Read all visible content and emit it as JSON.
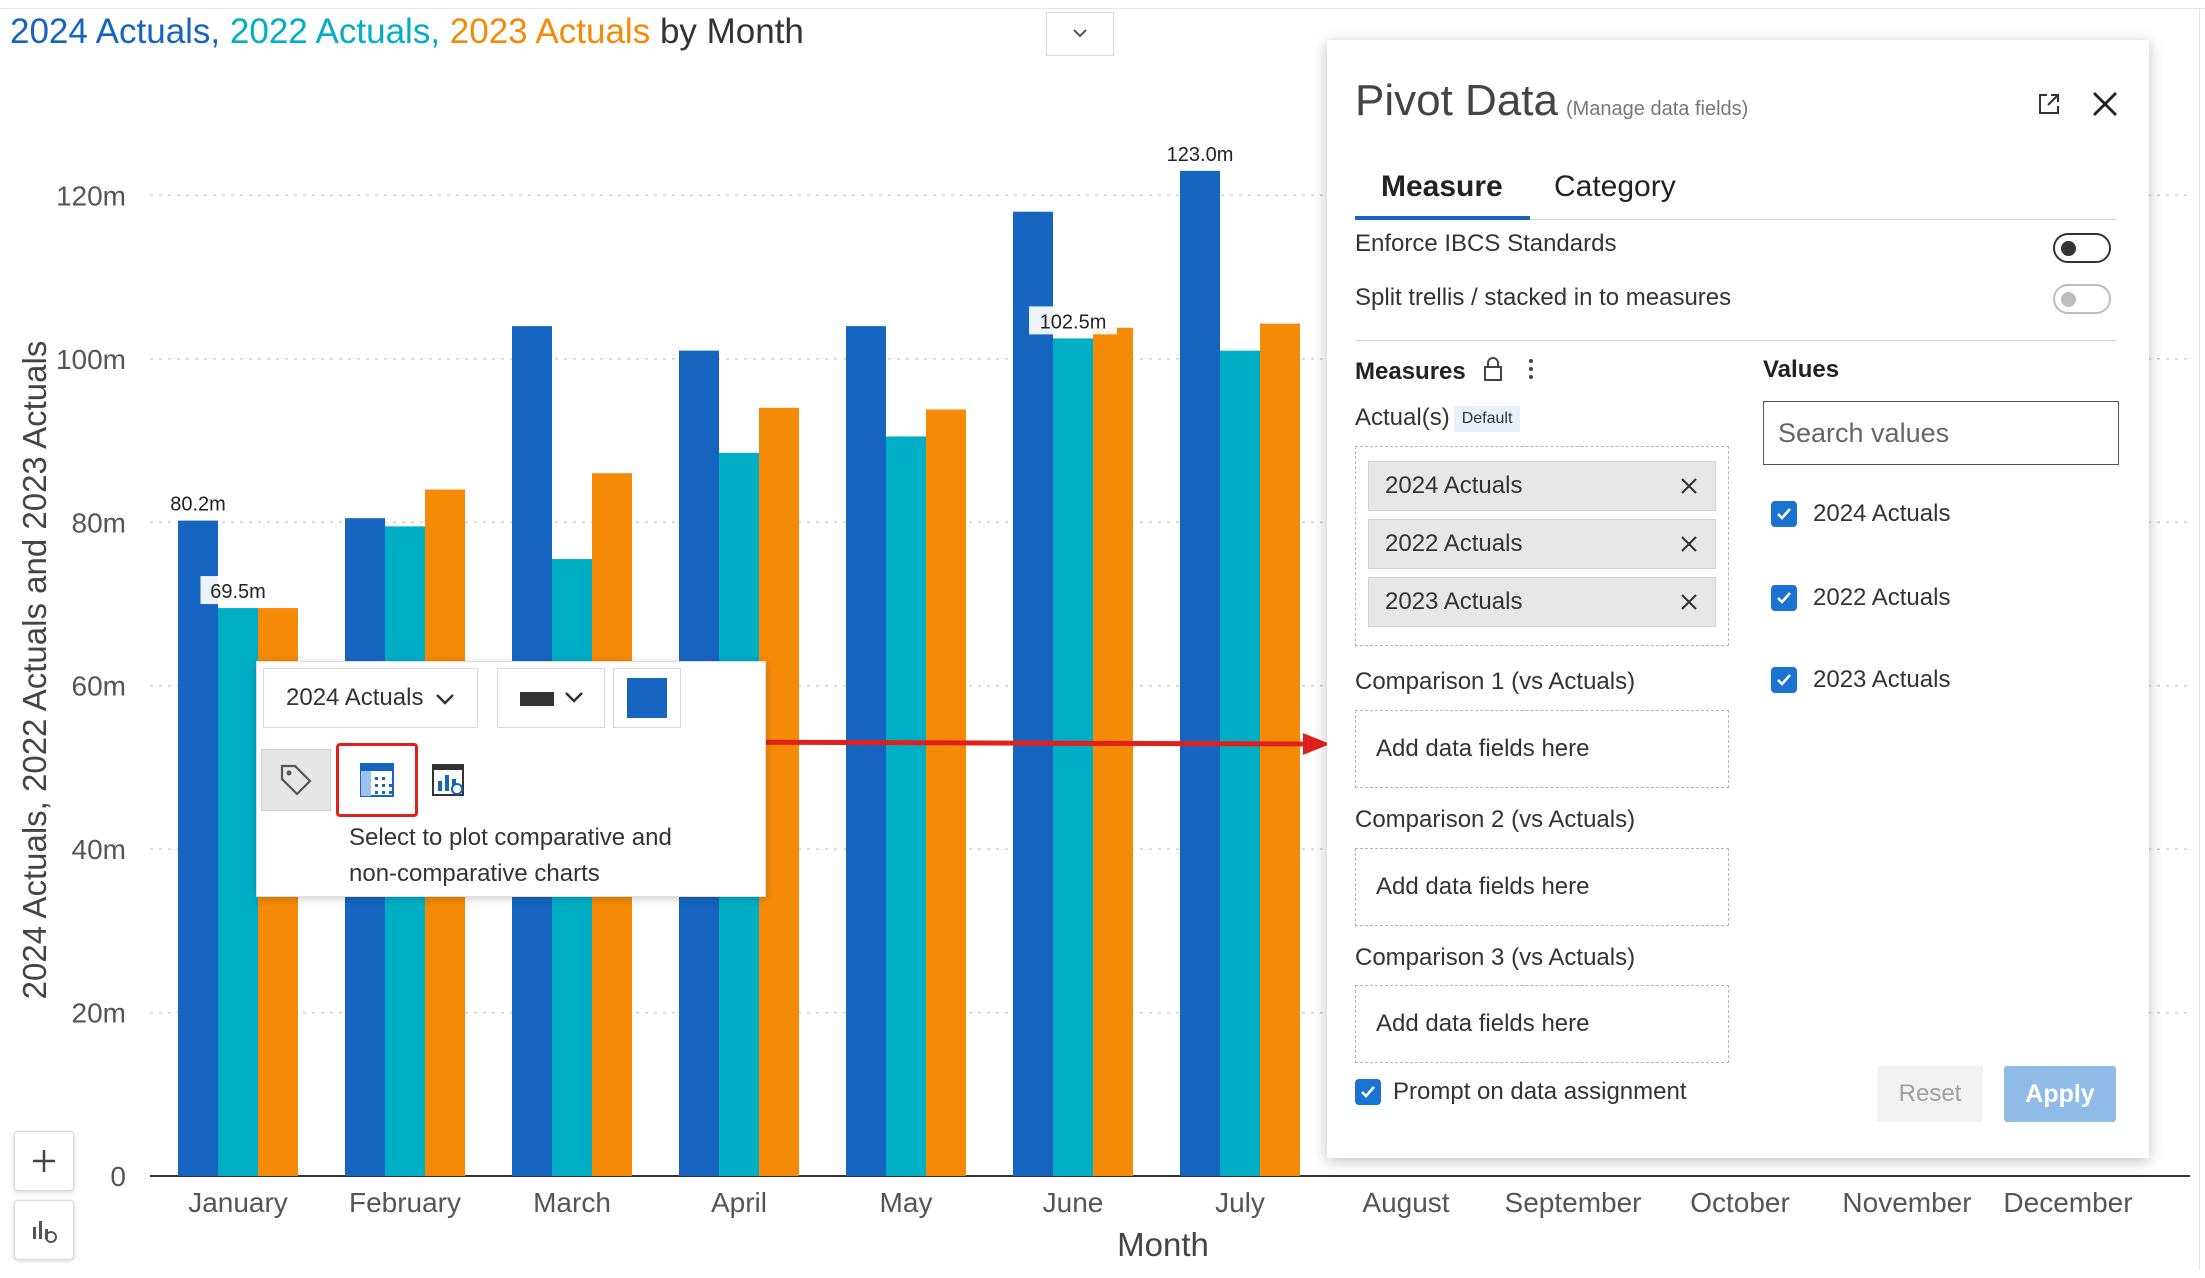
{
  "title": {
    "parts": [
      {
        "text": "2024 Actuals,",
        "color": "#1565c0"
      },
      {
        "text": "2022 Actuals,",
        "color": "#00aec6"
      },
      {
        "text": "2023 Actuals",
        "color": "#f58a07"
      },
      {
        "text": "by Month",
        "color": "#333333"
      }
    ]
  },
  "chart_data": {
    "type": "bar",
    "xlabel": "Month",
    "ylabel": "2024 Actuals, 2022 Actuals and 2023 Actuals",
    "ylim": [
      0,
      128
    ],
    "yticks": [
      0,
      20,
      40,
      60,
      80,
      100,
      120
    ],
    "ytick_labels": [
      "0",
      "20m",
      "40m",
      "60m",
      "80m",
      "100m",
      "120m"
    ],
    "grid": true,
    "categories": [
      "January",
      "February",
      "March",
      "April",
      "May",
      "June",
      "July",
      "August",
      "September",
      "October",
      "November",
      "December"
    ],
    "series": [
      {
        "name": "2024 Actuals",
        "color": "#1565c0",
        "values": [
          80.2,
          80.5,
          104,
          101,
          104,
          118,
          123.0,
          null,
          null,
          null,
          null,
          null
        ]
      },
      {
        "name": "2022 Actuals",
        "color": "#00aec6",
        "values": [
          69.5,
          79.5,
          75.5,
          88.5,
          90.5,
          102.5,
          101,
          null,
          null,
          null,
          null,
          null
        ]
      },
      {
        "name": "2023 Actuals",
        "color": "#f58a07",
        "values": [
          69.5,
          84,
          86,
          94,
          93.8,
          103.8,
          104.3,
          null,
          null,
          null,
          null,
          null
        ]
      }
    ],
    "data_labels": [
      {
        "series": 0,
        "index": 0,
        "text": "80.2m"
      },
      {
        "series": 1,
        "index": 0,
        "text": "69.5m"
      },
      {
        "series": 1,
        "index": 5,
        "text": "102.5m"
      },
      {
        "series": 0,
        "index": 6,
        "text": "123.0m"
      }
    ]
  },
  "context_menu": {
    "series_select": "2024 Actuals",
    "color": "#1565c0",
    "tooltip": "Select to plot comparative and non-comparative charts",
    "tooltip_lines": [
      "Select to plot comparative and",
      "non-comparative charts"
    ]
  },
  "panel": {
    "title": "Pivot Data",
    "subtitle": "(Manage data fields)",
    "tabs": [
      "Measure",
      "Category"
    ],
    "options": [
      {
        "label": "Enforce IBCS Standards",
        "on": false,
        "enabled": true
      },
      {
        "label": "Split trellis / stacked in to measures",
        "on": false,
        "enabled": false
      }
    ],
    "measures_heading": "Measures",
    "values_heading": "Values",
    "actuals_label": "Actual(s)",
    "default_badge": "Default",
    "actual_chips": [
      "2024 Actuals",
      "2022 Actuals",
      "2023 Actuals"
    ],
    "comparisons": [
      {
        "label": "Comparison 1 (vs Actuals)",
        "placeholder": "Add data fields here"
      },
      {
        "label": "Comparison 2 (vs Actuals)",
        "placeholder": "Add data fields here"
      },
      {
        "label": "Comparison 3 (vs Actuals)",
        "placeholder": "Add data fields here"
      }
    ],
    "search_placeholder": "Search values",
    "values": [
      "2024 Actuals",
      "2022 Actuals",
      "2023 Actuals"
    ],
    "prompt_label": "Prompt on data assignment",
    "reset_label": "Reset",
    "apply_label": "Apply"
  }
}
